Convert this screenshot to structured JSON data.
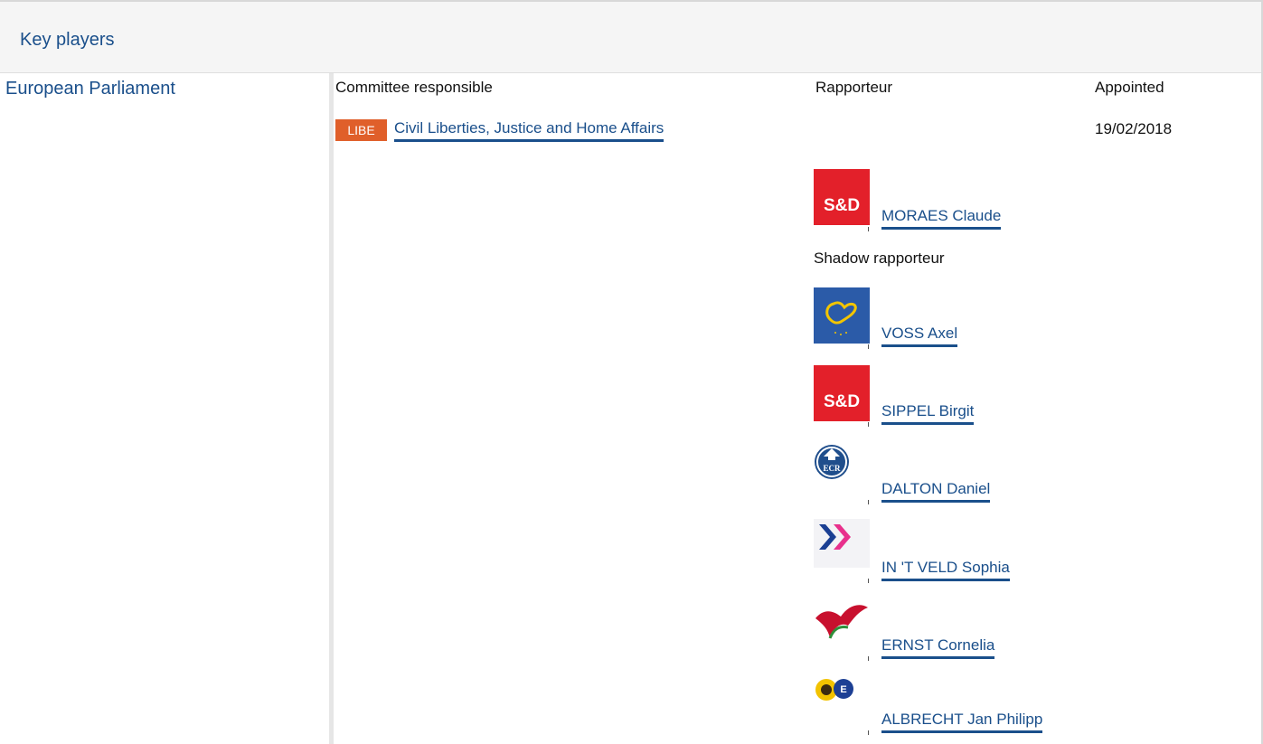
{
  "section": {
    "title": "Key players"
  },
  "institution": "European Parliament",
  "columns": {
    "committee": "Committee responsible",
    "rapporteur": "Rapporteur",
    "appointed": "Appointed"
  },
  "committee": {
    "code": "LIBE",
    "name": "Civil Liberties, Justice and Home Affairs",
    "badge_color": "#e05f2a",
    "appointed_date": "19/02/2018"
  },
  "rapporteurs": [
    {
      "name": "MORAES Claude",
      "group_icon": "sd-group-logo"
    }
  ],
  "shadow_label": "Shadow rapporteur",
  "shadow_rapporteurs": [
    {
      "name": "VOSS Axel",
      "group_icon": "epp-group-logo"
    },
    {
      "name": "SIPPEL Birgit",
      "group_icon": "sd-group-logo"
    },
    {
      "name": "DALTON Daniel",
      "group_icon": "ecr-group-logo"
    },
    {
      "name": "IN 'T VELD Sophia",
      "group_icon": "alde-group-logo"
    },
    {
      "name": "ERNST Cornelia",
      "group_icon": "gue-ngl-group-logo"
    },
    {
      "name": "ALBRECHT Jan Philipp",
      "group_icon": "greens-efa-group-logo"
    }
  ],
  "colors": {
    "link": "#1a4f8b",
    "sd_red": "#e3202a",
    "epp_blue": "#2b5ba8"
  }
}
